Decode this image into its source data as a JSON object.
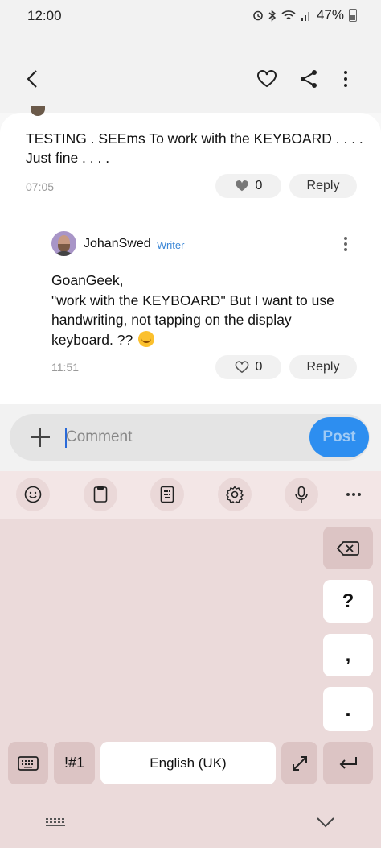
{
  "status_bar": {
    "time": "12:00",
    "battery": "47%"
  },
  "header": {
    "back_icon": "arrow-left-icon",
    "like_icon": "heart-outline-icon",
    "share_icon": "share-icon",
    "more_icon": "more-vertical-icon"
  },
  "comments": [
    {
      "text": "TESTING . SEEms To work with the KEYBOARD . . . . Just fine . . . .",
      "time": "07:05",
      "likes": "0",
      "reply_label": "Reply"
    },
    {
      "author": "JohanSwed",
      "role": "Writer",
      "text_line1": "GoanGeek,",
      "text_line2": "\"work with the KEYBOARD\" But I want to use handwriting, not tapping on the display keyboard. ??",
      "time": "11:51",
      "likes": "0",
      "reply_label": "Reply"
    }
  ],
  "comment_box": {
    "placeholder": "Comment",
    "post_label": "Post"
  },
  "keyboard": {
    "toolbar_icons": [
      "emoji-icon",
      "clipboard-icon",
      "keyboard-mode-icon",
      "settings-icon",
      "microphone-icon",
      "more-horizontal-icon"
    ],
    "keys": {
      "question": "?",
      "comma": ",",
      "period": ".",
      "symbols": "!#1",
      "space": "English (UK)"
    }
  }
}
